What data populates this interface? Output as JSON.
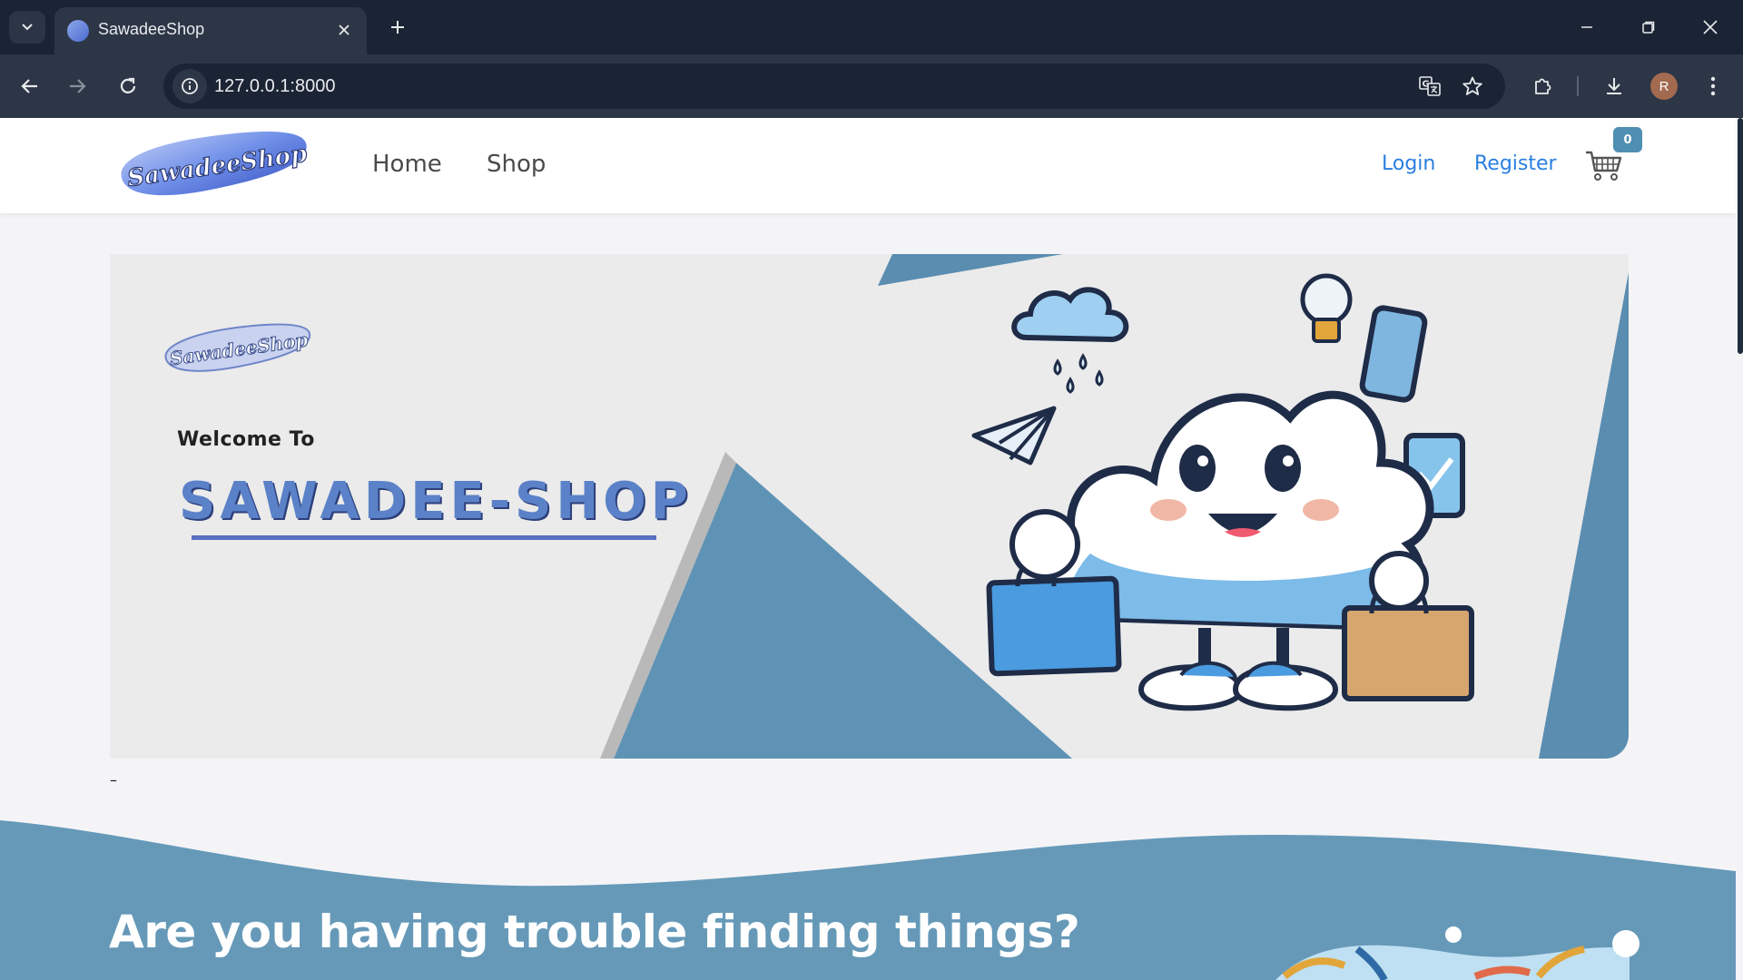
{
  "browser": {
    "tab_title": "SawadeeShop",
    "url": "127.0.0.1:8000",
    "avatar_letter": "R"
  },
  "site": {
    "logo_text": "SawadeeShop",
    "nav": {
      "home": "Home",
      "shop": "Shop"
    },
    "auth": {
      "login": "Login",
      "register": "Register"
    },
    "cart_count": "0"
  },
  "hero": {
    "logo_text": "SawadeeShop",
    "welcome": "Welcome To",
    "title": "SAWADEE-SHOP",
    "after": "–"
  },
  "section": {
    "heading": "Are you having trouble finding things?"
  },
  "colors": {
    "accent_blue": "#2a7fe0",
    "section_blue": "#6699b8",
    "hero_title": "#5b82c8",
    "chrome_dark": "#1b2434"
  }
}
